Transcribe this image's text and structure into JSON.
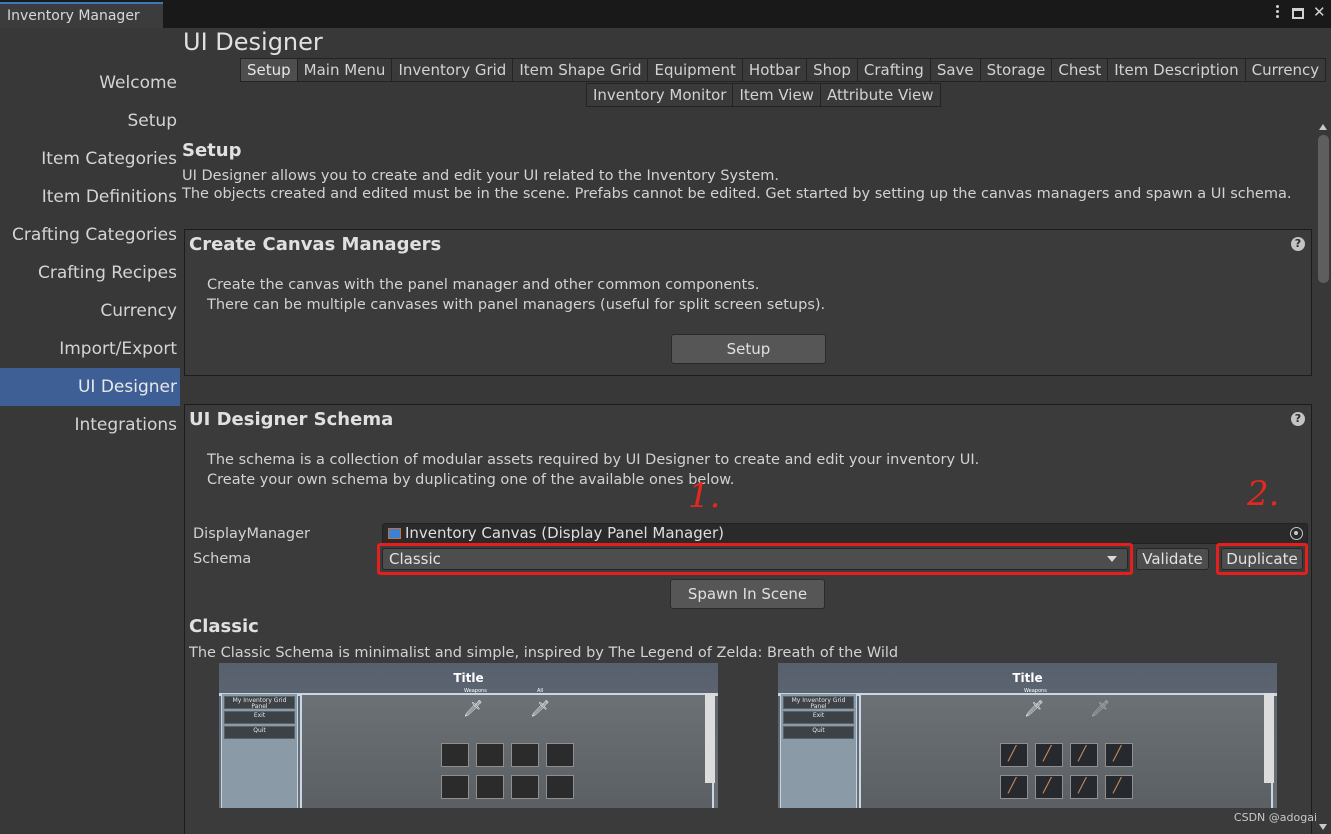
{
  "window": {
    "tab_title": "Inventory Manager"
  },
  "sidebar": {
    "items": [
      {
        "label": "Welcome"
      },
      {
        "label": "Setup"
      },
      {
        "label": "Item Categories"
      },
      {
        "label": "Item Definitions"
      },
      {
        "label": "Crafting Categories"
      },
      {
        "label": "Crafting Recipes"
      },
      {
        "label": "Currency"
      },
      {
        "label": "Import/Export"
      },
      {
        "label": "UI Designer",
        "active": true
      },
      {
        "label": "Integrations"
      }
    ]
  },
  "main": {
    "title": "UI Designer",
    "tabs_row1": [
      "Setup",
      "Main Menu",
      "Inventory Grid",
      "Item Shape Grid",
      "Equipment",
      "Hotbar",
      "Shop",
      "Crafting",
      "Save",
      "Storage",
      "Chest",
      "Item Description",
      "Currency"
    ],
    "tabs_row2": [
      "Inventory Monitor",
      "Item View",
      "Attribute View"
    ],
    "active_tab": "Setup"
  },
  "setup": {
    "heading": "Setup",
    "desc_line1": "UI Designer allows you to create and edit your UI related to the Inventory System.",
    "desc_line2": "The objects created and edited must be in the scene. Prefabs cannot be edited. Get started by setting up the canvas managers and spawn a UI schema."
  },
  "canvas_box": {
    "title": "Create Canvas Managers",
    "line1": "Create the canvas with the panel manager and other common components.",
    "line2": "There can be multiple canvases with panel managers (useful for split screen setups).",
    "button": "Setup"
  },
  "schema_box": {
    "title": "UI Designer Schema",
    "line1": "The schema is a collection of modular assets required by UI Designer to create and edit your inventory UI.",
    "line2": "Create your own schema by duplicating one of the available ones below.",
    "display_manager_label": "DisplayManager",
    "display_manager_value": "Inventory Canvas (Display Panel Manager)",
    "schema_label": "Schema",
    "schema_value": "Classic",
    "validate_button": "Validate",
    "duplicate_button": "Duplicate",
    "spawn_button": "Spawn In Scene",
    "annotation_1": "1.",
    "annotation_2": "2."
  },
  "classic": {
    "heading": "Classic",
    "description": "The Classic Schema is minimalist and simple, inspired by The Legend of Zelda: Breath of the Wild",
    "preview_left": {
      "title": "Title",
      "sub1": "Weapons",
      "sub2": "All",
      "menu": [
        "My Inventory Grid Panel",
        "Exit",
        "Quit"
      ]
    },
    "preview_right": {
      "title": "Title",
      "sub1": "Weapons",
      "menu": [
        "My Inventory Grid Panel",
        "Exit",
        "Quit"
      ]
    }
  },
  "watermark": "CSDN @adogai",
  "colors": {
    "accent": "#3e5f96",
    "annotation_red": "#e51e1e",
    "background": "#383838"
  }
}
